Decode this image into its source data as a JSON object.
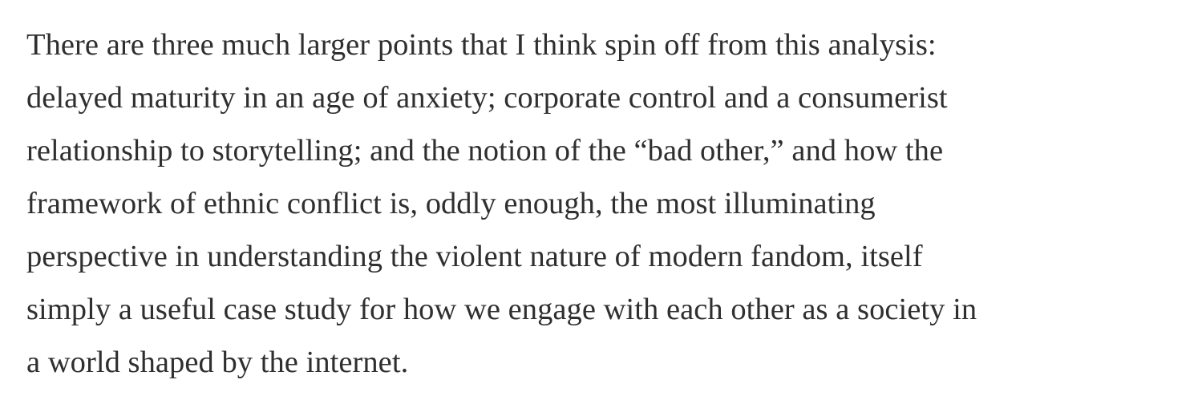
{
  "article": {
    "paragraph_lines": [
      "There are three much larger points that I think spin off from this analysis:",
      "delayed maturity in an age of anxiety; corporate control and a consumerist",
      "relationship to storytelling; and the notion of the “bad other,” and how the",
      "framework of ethnic conflict is, oddly enough, the most illuminating",
      "perspective in understanding the violent nature of modern fandom, itself",
      "simply a useful case study for how we engage with each other as a society in",
      "a world shaped by the internet."
    ]
  },
  "colors": {
    "text": "#2f2f2f",
    "background": "#ffffff"
  }
}
